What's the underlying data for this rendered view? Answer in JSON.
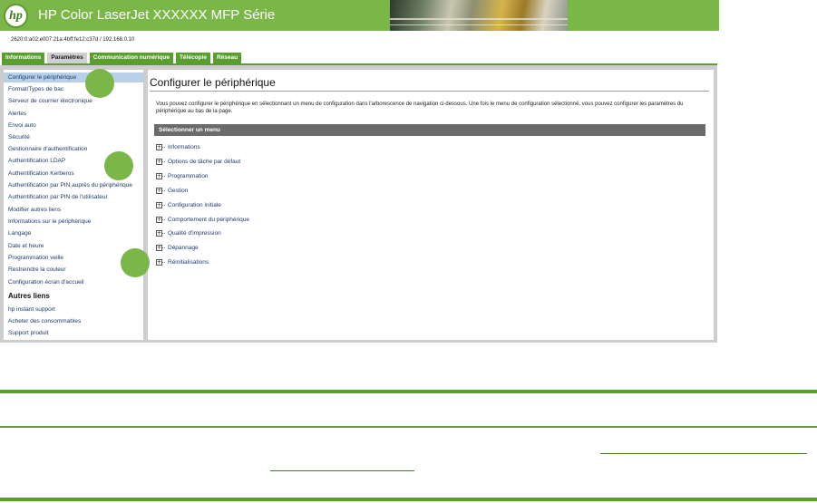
{
  "header": {
    "logo_text": "hp",
    "title": "HP Color LaserJet XXXXXX MFP Série",
    "address": "2620:0:a02:e007:21a:4bff:fe12:c37d / 192.168.0.10"
  },
  "tabs": [
    {
      "label": "Informations"
    },
    {
      "label": "Paramètres"
    },
    {
      "label": "Communication numérique"
    },
    {
      "label": "Télécopie"
    },
    {
      "label": "Réseau"
    }
  ],
  "sidebar": {
    "items": [
      {
        "label": "Configurer le périphérique"
      },
      {
        "label": "Format/Types de bac"
      },
      {
        "label": "Serveur de courrier électronique"
      },
      {
        "label": "Alertes"
      },
      {
        "label": "Envoi auto"
      },
      {
        "label": "Sécurité"
      },
      {
        "label": "Gestionnaire d'authentification"
      },
      {
        "label": "Authentification LDAP"
      },
      {
        "label": "Authentification Kerberos"
      },
      {
        "label": "Authentification par PIN auprès du périphérique"
      },
      {
        "label": "Authentification par PIN de l'utilisateur"
      },
      {
        "label": "Modifier autres liens"
      },
      {
        "label": "Informations sur le périphérique"
      },
      {
        "label": "Langage"
      },
      {
        "label": "Date et heure"
      },
      {
        "label": "Programmation veille"
      },
      {
        "label": "Restreindre la couleur"
      },
      {
        "label": "Configuration écran d'accueil"
      }
    ],
    "other_heading": "Autres liens",
    "other_links": [
      {
        "label": "hp instant support"
      },
      {
        "label": "Acheter des consommables"
      },
      {
        "label": "Support produit"
      }
    ]
  },
  "content": {
    "title": "Configurer le périphérique",
    "intro": "Vous pouvez configurer le périphérique en sélectionnant un menu de configuration dans l'arborescence de navigation ci-dessous. Une fois le menu de configuration sélectionné, vous pouvez configurer les paramètres du périphérique au bas de la page.",
    "menu_header": "Sélectionner un menu",
    "menu_items": [
      {
        "label": "Informations"
      },
      {
        "label": "Options de tâche par défaut"
      },
      {
        "label": "Programmation"
      },
      {
        "label": "Gestion"
      },
      {
        "label": "Configuration initiale"
      },
      {
        "label": "Comportement du périphérique"
      },
      {
        "label": "Qualité d'impression"
      },
      {
        "label": "Dépannage"
      },
      {
        "label": "Réinitialisations"
      }
    ],
    "expander_symbol": "+"
  },
  "colors": {
    "brand_green": "#7ab648",
    "tab_green": "#5a9e2f",
    "active_tab": "#cfcfcf",
    "selection": "#b8d0e8",
    "menu_bar": "#6b6b6b"
  }
}
